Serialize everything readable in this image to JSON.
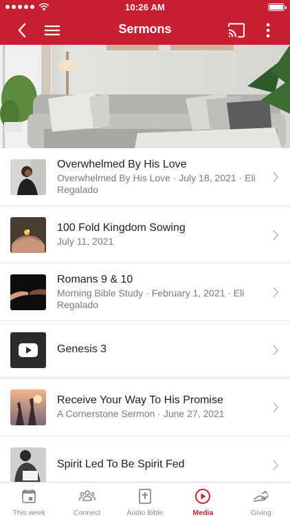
{
  "status_bar": {
    "time": "10:26 AM"
  },
  "nav": {
    "title": "Sermons"
  },
  "sermons": [
    {
      "title": "Overwhelmed By His Love",
      "subtitle": "Overwhelmed By His Love · July 18, 2021 · Eli Regalado",
      "thumb": "woman-praying"
    },
    {
      "title": "100 Fold Kingdom Sowing",
      "subtitle": "July 11, 2021",
      "thumb": "hands-seed"
    },
    {
      "title": "Romans 9 & 10",
      "subtitle": "Morning Bible Study · February 1, 2021 · Eli Regalado",
      "thumb": "hands-reaching"
    },
    {
      "title": "Genesis 3",
      "subtitle": "",
      "thumb": "youtube-icon"
    },
    {
      "title": "Receive Your Way To His Promise",
      "subtitle": "A Cornerstone Sermon · June 27, 2021",
      "thumb": "worship-hands"
    },
    {
      "title": "Spirit Led To Be Spirit Fed",
      "subtitle": "",
      "thumb": "person-reading"
    }
  ],
  "tabs": [
    {
      "label": "This week",
      "icon": "calendar-icon",
      "active": false
    },
    {
      "label": "Connect",
      "icon": "people-icon",
      "active": false
    },
    {
      "label": "Audio Bible",
      "icon": "bible-icon",
      "active": false
    },
    {
      "label": "Media",
      "icon": "play-circle-icon",
      "active": true
    },
    {
      "label": "Giving",
      "icon": "giving-hands-icon",
      "active": false
    }
  ],
  "colors": {
    "brand": "#c62032",
    "inactive": "#8a8a8a"
  }
}
